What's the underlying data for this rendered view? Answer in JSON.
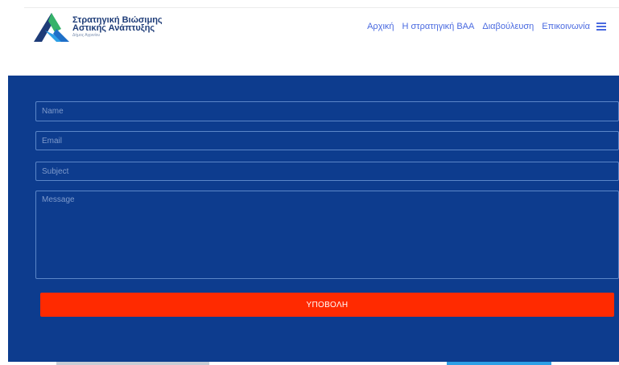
{
  "logo": {
    "title_line1": "Στρατηγική Βιώσιμης",
    "title_line2": "Αστικής Ανάπτυξης",
    "subtitle": "Δήμος Αγρινίου"
  },
  "nav": {
    "items": [
      {
        "label": "Αρχική"
      },
      {
        "label": "Η στρατηγική ΒΑΑ"
      },
      {
        "label": "Διαβούλευση"
      },
      {
        "label": "Επικοινωνία"
      }
    ],
    "menu_icon": "hamburger-icon"
  },
  "form": {
    "name_placeholder": "Name",
    "email_placeholder": "Email",
    "subject_placeholder": "Subject",
    "message_placeholder": "Message",
    "submit_label": "ΥΠΟΒΟΛΗ"
  },
  "colors": {
    "panel": "#0d3c8e",
    "submit": "#ff2a00",
    "nav_link": "#4a6ae0",
    "brand": "#1e3c78"
  }
}
